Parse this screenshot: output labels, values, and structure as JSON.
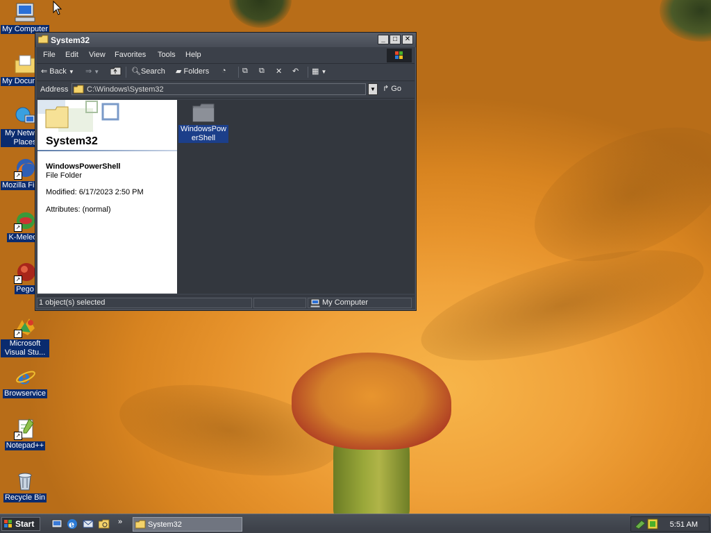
{
  "desktop": {
    "icons": [
      {
        "label": "My Computer",
        "icon": "my-computer-icon"
      },
      {
        "label": "My Documents",
        "icon": "my-documents-icon"
      },
      {
        "label": "My Network Places",
        "icon": "network-places-icon"
      },
      {
        "label": "Mozilla Firefox",
        "icon": "firefox-icon"
      },
      {
        "label": "K-Meleon",
        "icon": "kmeleon-icon"
      },
      {
        "label": "Pego",
        "icon": "pego-icon"
      },
      {
        "label": "Microsoft Visual Stu...",
        "icon": "visual-studio-icon"
      },
      {
        "label": "Browservice",
        "icon": "internet-explorer-icon"
      },
      {
        "label": "Notepad++",
        "icon": "notepadpp-icon"
      },
      {
        "label": "Recycle Bin",
        "icon": "recycle-bin-icon"
      }
    ]
  },
  "window": {
    "title": "System32",
    "menu": [
      "File",
      "Edit",
      "View",
      "Favorites",
      "Tools",
      "Help"
    ],
    "toolbar": {
      "back": "Back",
      "search": "Search",
      "folders": "Folders"
    },
    "address": {
      "label": "Address",
      "value": "C:\\Windows\\System32",
      "go": "Go"
    },
    "details": {
      "folder_title": "System32",
      "selected_name": "WindowsPowerShell",
      "selected_type": "File Folder",
      "modified": "Modified: 6/17/2023 2:50 PM",
      "attributes": "Attributes: (normal)"
    },
    "items": [
      {
        "name": "WindowsPowerShell"
      }
    ],
    "status": {
      "selection": "1 object(s) selected",
      "zone": "My Computer"
    }
  },
  "taskbar": {
    "start": "Start",
    "task": "System32",
    "clock": "5:51 AM"
  }
}
